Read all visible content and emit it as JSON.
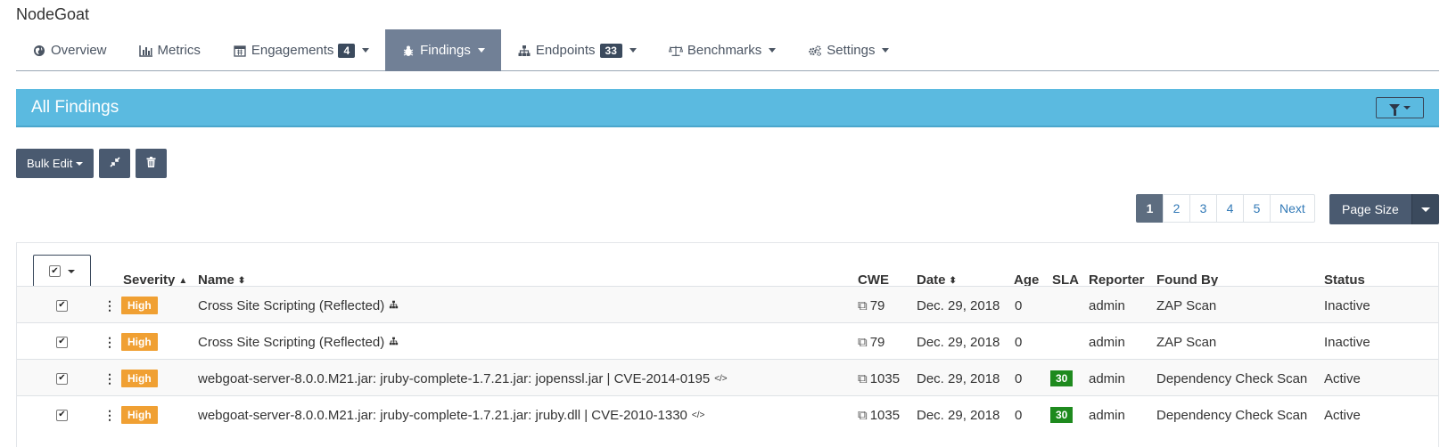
{
  "app": {
    "title": "NodeGoat"
  },
  "nav": {
    "items": [
      {
        "label": "Overview",
        "icon": "globe-icon",
        "badge": null,
        "caret": false,
        "active": false
      },
      {
        "label": "Metrics",
        "icon": "bar-chart-icon",
        "badge": null,
        "caret": false,
        "active": false
      },
      {
        "label": "Engagements",
        "icon": "calendar-icon",
        "badge": "4",
        "caret": true,
        "active": false
      },
      {
        "label": "Findings",
        "icon": "bug-icon",
        "badge": null,
        "caret": true,
        "active": true
      },
      {
        "label": "Endpoints",
        "icon": "sitemap-icon",
        "badge": "33",
        "caret": true,
        "active": false
      },
      {
        "label": "Benchmarks",
        "icon": "balance-scale-icon",
        "badge": null,
        "caret": true,
        "active": false
      },
      {
        "label": "Settings",
        "icon": "cogs-icon",
        "badge": null,
        "caret": true,
        "active": false
      }
    ]
  },
  "panel": {
    "title": "All Findings"
  },
  "toolbar": {
    "bulk_edit_label": "Bulk Edit"
  },
  "pagination": {
    "pages": [
      "1",
      "2",
      "3",
      "4",
      "5"
    ],
    "current": "1",
    "next_label": "Next",
    "page_size_label": "Page Size"
  },
  "table": {
    "headers": {
      "severity": "Severity",
      "name": "Name",
      "cwe": "CWE",
      "date": "Date",
      "age": "Age",
      "sla": "SLA",
      "reporter": "Reporter",
      "found_by": "Found By",
      "status": "Status"
    },
    "rows": [
      {
        "checked": true,
        "severity": "High",
        "name": "Cross Site Scripting (Reflected)",
        "name_icon": "sitemap-icon",
        "cwe": "79",
        "date": "Dec. 29, 2018",
        "age": "0",
        "sla": "",
        "reporter": "admin",
        "found_by": "ZAP Scan",
        "status": "Inactive"
      },
      {
        "checked": true,
        "severity": "High",
        "name": "Cross Site Scripting (Reflected)",
        "name_icon": "sitemap-icon",
        "cwe": "79",
        "date": "Dec. 29, 2018",
        "age": "0",
        "sla": "",
        "reporter": "admin",
        "found_by": "ZAP Scan",
        "status": "Inactive"
      },
      {
        "checked": true,
        "severity": "High",
        "name": "webgoat-server-8.0.0.M21.jar: jruby-complete-1.7.21.jar: jopenssl.jar | CVE-2014-0195",
        "name_icon": "code-icon",
        "cwe": "1035",
        "date": "Dec. 29, 2018",
        "age": "0",
        "sla": "30",
        "reporter": "admin",
        "found_by": "Dependency Check Scan",
        "status": "Active"
      },
      {
        "checked": true,
        "severity": "High",
        "name": "webgoat-server-8.0.0.M21.jar: jruby-complete-1.7.21.jar: jruby.dll | CVE-2010-1330",
        "name_icon": "code-icon",
        "cwe": "1035",
        "date": "Dec. 29, 2018",
        "age": "0",
        "sla": "30",
        "reporter": "admin",
        "found_by": "Dependency Check Scan",
        "status": "Active"
      }
    ]
  },
  "colors": {
    "accent": "#5bbae0",
    "nav_active": "#718096",
    "button": "#4a5a70",
    "severity_high": "#f0a033",
    "sla_ok": "#1e8a1e"
  }
}
